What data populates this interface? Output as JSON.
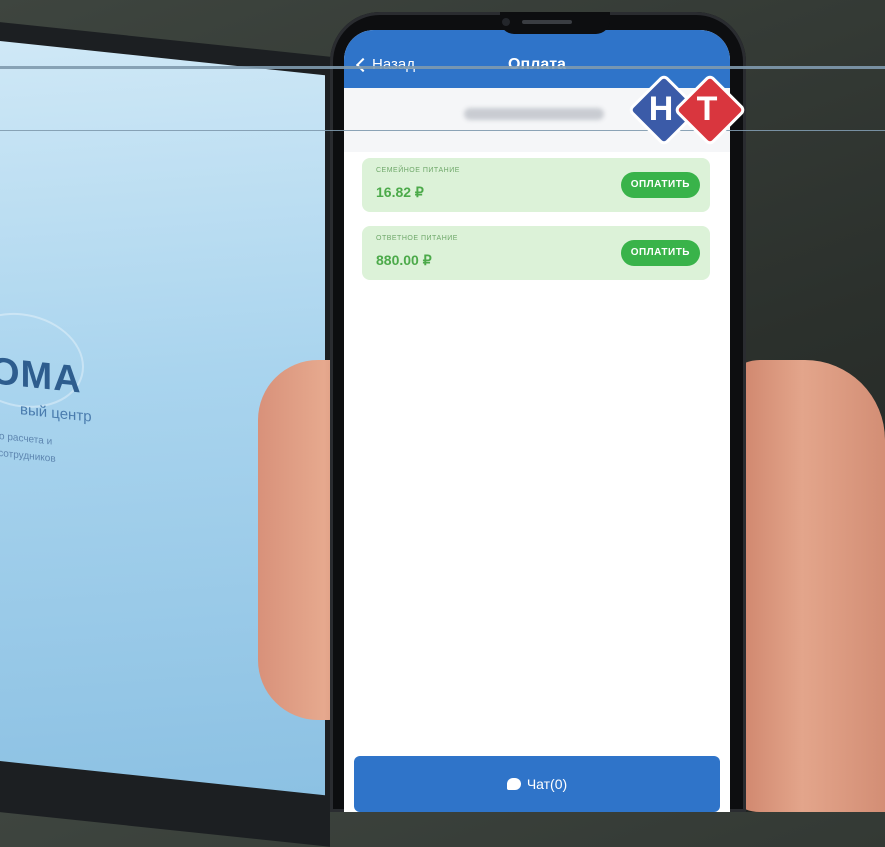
{
  "header": {
    "back_label": "Назад",
    "title": "Оплата"
  },
  "payments": [
    {
      "label": "СЕМЕЙНОЕ ПИТАНИЕ",
      "amount": "16.82 ₽",
      "button": "ОПЛАТИТЬ"
    },
    {
      "label": "ОТВЕТНОЕ ПИТАНИЕ",
      "amount": "880.00 ₽",
      "button": "ОПЛАТИТЬ"
    }
  ],
  "chat": {
    "label": "Чат(0)"
  },
  "monitor": {
    "brand": "OMA",
    "subtitle": "вый центр",
    "line1": "ого расчета и",
    "line2": "я сотрудников"
  },
  "logo": {
    "letter1": "H",
    "letter2": "T"
  },
  "colors": {
    "header_blue": "#2f74c9",
    "pay_green": "#39b34a",
    "card_green": "#dcf2d8",
    "logo_blue": "#3b5ba8",
    "logo_red": "#d9363e"
  }
}
